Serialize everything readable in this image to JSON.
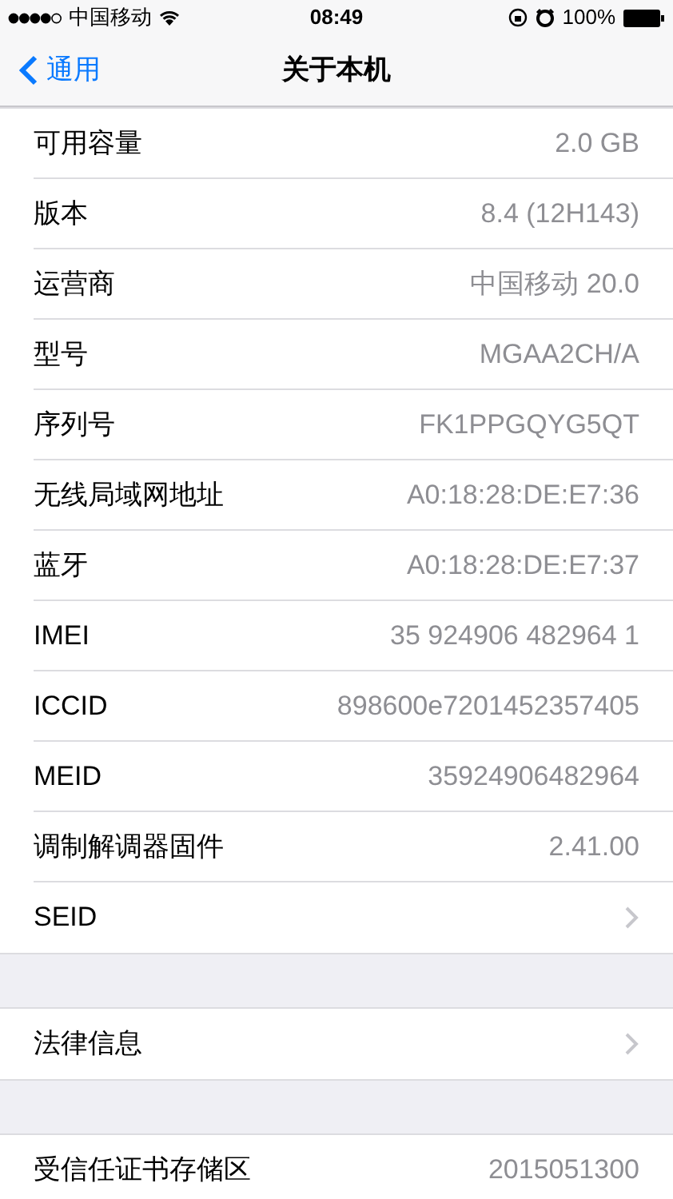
{
  "status_bar": {
    "carrier": "中国移动",
    "time": "08:49",
    "battery": "100%"
  },
  "nav_bar": {
    "back": "通用",
    "title": "关于本机"
  },
  "sections": [
    {
      "rows": [
        {
          "kind": "value",
          "label": "可用容量",
          "value": "2.0 GB"
        },
        {
          "kind": "value",
          "label": "版本",
          "value": "8.4 (12H143)"
        },
        {
          "kind": "value",
          "label": "运营商",
          "value": "中国移动 20.0"
        },
        {
          "kind": "value",
          "label": "型号",
          "value": "MGAA2CH/A"
        },
        {
          "kind": "value",
          "label": "序列号",
          "value": "FK1PPGQYG5QT"
        },
        {
          "kind": "value",
          "label": "无线局域网地址",
          "value": "A0:18:28:DE:E7:36"
        },
        {
          "kind": "value",
          "label": "蓝牙",
          "value": "A0:18:28:DE:E7:37"
        },
        {
          "kind": "value",
          "label": "IMEI",
          "value": "35 924906 482964 1"
        },
        {
          "kind": "value",
          "label": "ICCID",
          "value": "898600e7201452357405"
        },
        {
          "kind": "value",
          "label": "MEID",
          "value": "35924906482964"
        },
        {
          "kind": "value",
          "label": "调制解调器固件",
          "value": "2.41.00"
        },
        {
          "kind": "link",
          "label": "SEID"
        }
      ]
    },
    {
      "rows": [
        {
          "kind": "link",
          "label": "法律信息"
        }
      ]
    },
    {
      "rows": [
        {
          "kind": "value",
          "label": "受信任证书存储区",
          "value": "2015051300"
        }
      ]
    }
  ]
}
